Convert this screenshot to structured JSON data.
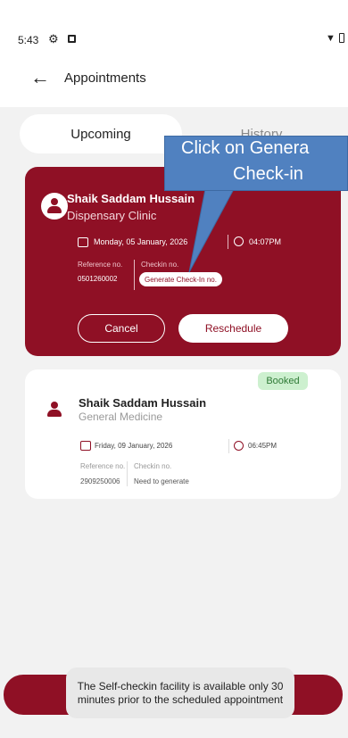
{
  "status_bar": {
    "time": "5:43"
  },
  "header": {
    "title": "Appointments"
  },
  "tabs": [
    {
      "label": "Upcoming",
      "active": true
    },
    {
      "label": "History",
      "active": false
    }
  ],
  "appointments": [
    {
      "name": "Shaik Saddam Hussain",
      "department": "Dispensary Clinic",
      "date": "Monday, 05 January, 2026",
      "time": "04:07PM",
      "reference_label": "Reference no.",
      "reference_no": "0501260002",
      "checkin_label": "Checkin no.",
      "checkin_action": "Generate Check-In no.",
      "cancel_label": "Cancel",
      "reschedule_label": "Reschedule"
    },
    {
      "status": "Booked",
      "name": "Shaik Saddam Hussain",
      "department": "General Medicine",
      "date": "Friday, 09 January, 2026",
      "time": "06:45PM",
      "reference_label": "Reference no.",
      "reference_no": "2909250006",
      "checkin_label": "Checkin no.",
      "checkin_value": "Need to generate"
    }
  ],
  "callout": {
    "line1": "Click on Genera",
    "line2": "Check-in"
  },
  "toast": "The Self-checkin facility is available only 30 minutes prior to the scheduled appointment",
  "colors": {
    "brand": "#8f1025",
    "background": "#f2f2f2",
    "badge_bg": "#cdf0cf",
    "badge_text": "#2f7a36",
    "callout": "#5081c0"
  },
  "icons": [
    "gear-icon",
    "notification-icon",
    "wifi-icon",
    "battery-icon",
    "back-arrow-icon",
    "person-icon",
    "calendar-icon",
    "clock-icon"
  ]
}
